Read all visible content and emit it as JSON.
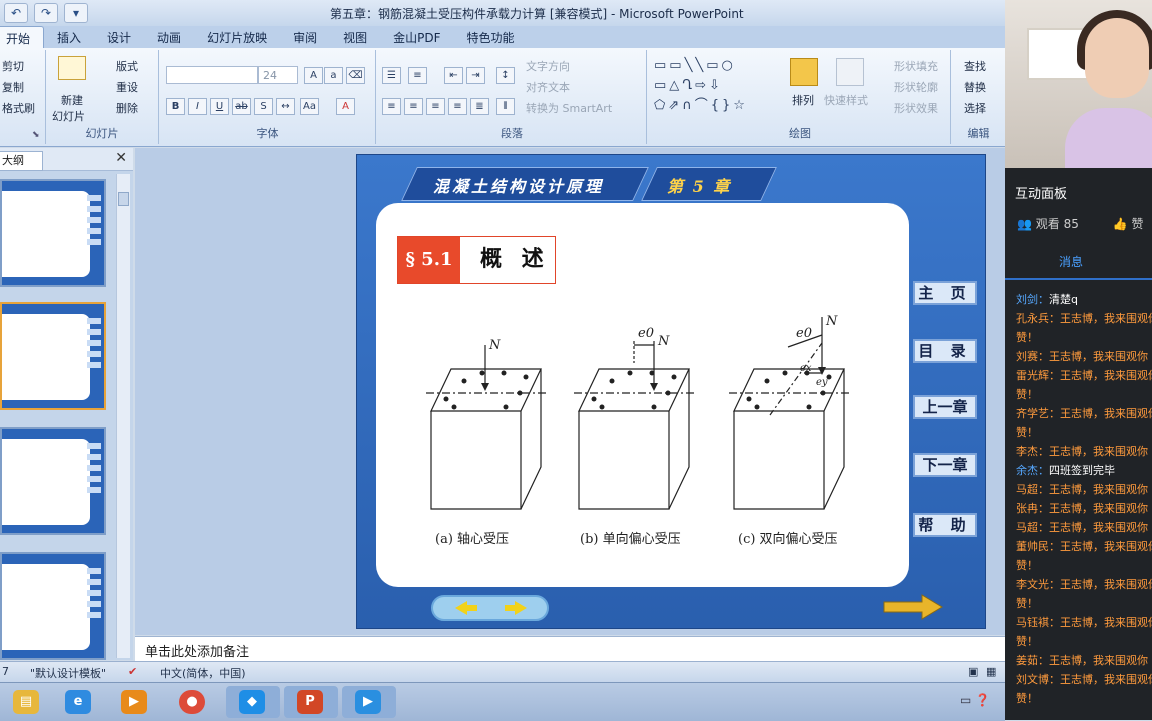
{
  "window": {
    "title": "第五章：钢筋混凝土受压构件承载力计算 [兼容模式] - Microsoft PowerPoint"
  },
  "ribbon": {
    "tabs": [
      "开始",
      "插入",
      "设计",
      "动画",
      "幻灯片放映",
      "审阅",
      "视图",
      "金山PDF",
      "特色功能"
    ],
    "clipboard": {
      "cut": "剪切",
      "copy": "复制",
      "format_painter": "格式刷"
    },
    "slides": {
      "new_slide": "新建",
      "new_slide2": "幻灯片",
      "layout": "版式",
      "reset": "重设",
      "delete": "删除",
      "label": "幻灯片"
    },
    "font": {
      "font_size": "24",
      "label": "字体"
    },
    "paragraph": {
      "text_direction": "文字方向",
      "align_text": "对齐文本",
      "smartart": "转换为 SmartArt",
      "label": "段落"
    },
    "drawing": {
      "arrange": "排列",
      "quick_styles": "快速样式",
      "shape_fill": "形状填充",
      "shape_outline": "形状轮廓",
      "shape_effects": "形状效果",
      "label": "绘图"
    },
    "editing": {
      "find": "查找",
      "replace": "替换",
      "select": "选择",
      "label": "编辑"
    }
  },
  "left_panel": {
    "tab_label": "大纲",
    "close": "✕"
  },
  "slide": {
    "header_title": "混凝土结构设计原理",
    "header_chapter": "第 5 章",
    "section_number": "§ 5.1",
    "section_title": "概 述",
    "nav_buttons": [
      "主 页",
      "目 录",
      "上一章",
      "下一章",
      "帮 助"
    ],
    "figures": [
      {
        "caption": "(a) 轴心受压",
        "load": "N"
      },
      {
        "caption": "(b) 单向偏心受压",
        "load": "N",
        "ecc": "e0"
      },
      {
        "caption": "(c) 双向偏心受压",
        "load": "N",
        "ecc": "e0",
        "ecc_x": "ex",
        "ecc_y": "ey"
      }
    ]
  },
  "notes": {
    "placeholder": "单击此处添加备注"
  },
  "status_bar": {
    "slide_no": "7",
    "theme": "\"默认设计模板\"",
    "language": "中文(简体，中国)"
  },
  "interaction_panel": {
    "title": "互动面板",
    "views": "观看 85",
    "likes": "赞",
    "messages_tab": "消息",
    "messages": [
      {
        "name": "刘剑：",
        "text": "清楚q",
        "color": "blue"
      },
      {
        "name": "孔永兵：",
        "text": "王志博，我来围观你",
        "color": "orange"
      },
      {
        "name": "",
        "text": "赞！",
        "color": "orange"
      },
      {
        "name": "刘赛：",
        "text": "王志博，我来围观你",
        "color": "orange"
      },
      {
        "name": "雷光辉：",
        "text": "王志博，我来围观你",
        "color": "orange"
      },
      {
        "name": "",
        "text": "赞！",
        "color": "orange"
      },
      {
        "name": "齐学艺：",
        "text": "王志博，我来围观你",
        "color": "orange"
      },
      {
        "name": "",
        "text": "赞！",
        "color": "orange"
      },
      {
        "name": "李杰：",
        "text": "王志博，我来围观你",
        "color": "orange"
      },
      {
        "name": "余杰：",
        "text": "四班签到完毕",
        "color": "blue"
      },
      {
        "name": "马超：",
        "text": "王志博，我来围观你",
        "color": "orange"
      },
      {
        "name": "张冉：",
        "text": "王志博，我来围观你",
        "color": "orange"
      },
      {
        "name": "马超：",
        "text": "王志博，我来围观你",
        "color": "orange"
      },
      {
        "name": "董帅民：",
        "text": "王志博，我来围观你",
        "color": "orange"
      },
      {
        "name": "",
        "text": "赞！",
        "color": "orange"
      },
      {
        "name": "李文光：",
        "text": "王志博，我来围观你",
        "color": "orange"
      },
      {
        "name": "",
        "text": "赞！",
        "color": "orange"
      },
      {
        "name": "马钰褀：",
        "text": "王志博，我来围观你",
        "color": "orange"
      },
      {
        "name": "",
        "text": "赞！",
        "color": "orange"
      },
      {
        "name": "姜茹：",
        "text": "王志博，我来围观你",
        "color": "orange"
      },
      {
        "name": "刘文博：",
        "text": "王志博，我来围观你",
        "color": "orange"
      },
      {
        "name": "",
        "text": "赞！",
        "color": "orange"
      }
    ]
  },
  "colors": {
    "slide_blue": "#2f6bc0",
    "section_red": "#e84a2b",
    "chat_orange": "#ff9b3d",
    "chat_blue": "#56a8ff"
  }
}
